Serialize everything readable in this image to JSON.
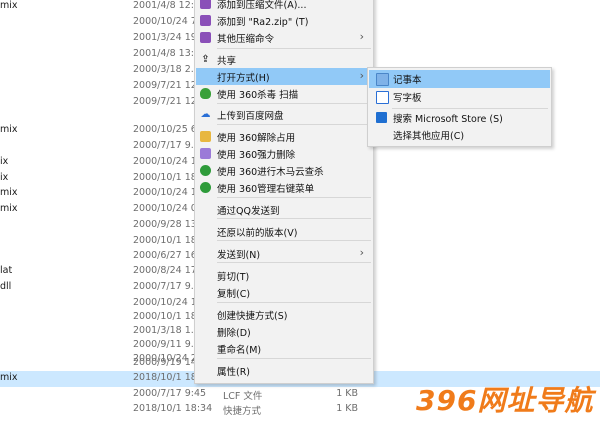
{
  "files": [
    {
      "name": "mix",
      "date": "2001/4/8 12:...",
      "type": "",
      "size": ""
    },
    {
      "name": "",
      "date": "2000/10/24 7...",
      "type": "",
      "size": ""
    },
    {
      "name": "",
      "date": "2001/3/24 19...",
      "type": "",
      "size": ""
    },
    {
      "name": "",
      "date": "2001/4/8 13:...",
      "type": "",
      "size": ""
    },
    {
      "name": "",
      "date": "2000/3/18 2...",
      "type": "",
      "size": ""
    },
    {
      "name": "",
      "date": "2009/7/21 12...",
      "type": "",
      "size": ""
    },
    {
      "name": "",
      "date": "2009/7/21 12...",
      "type": "",
      "size": ""
    },
    {
      "name": "mix",
      "date": "2000/10/25 6...",
      "type": "",
      "size": ""
    },
    {
      "name": "",
      "date": "2000/7/17 9...",
      "type": "",
      "size": ""
    },
    {
      "name": "ix",
      "date": "2000/10/24 1...",
      "type": "",
      "size": ""
    },
    {
      "name": "ix",
      "date": "2000/10/1 18...",
      "type": "",
      "size": ""
    },
    {
      "name": "mix",
      "date": "2000/10/24 1...",
      "type": "",
      "size": ""
    },
    {
      "name": "mix",
      "date": "2000/10/24 0...",
      "type": "",
      "size": ""
    },
    {
      "name": "",
      "date": "2000/9/28 13...",
      "type": "",
      "size": ""
    },
    {
      "name": "",
      "date": "2000/10/1 18...",
      "type": "",
      "size": ""
    },
    {
      "name": "",
      "date": "2000/6/27 16...",
      "type": "",
      "size": ""
    },
    {
      "name": "lat",
      "date": "2000/8/24 17...",
      "type": "",
      "size": ""
    },
    {
      "name": "dll",
      "date": "2000/7/17 9...",
      "type": "",
      "size": ""
    },
    {
      "name": "",
      "date": "2000/10/24 1...",
      "type": "",
      "size": ""
    },
    {
      "name": "",
      "date": "2000/10/1 18...",
      "type": "",
      "size": ""
    },
    {
      "name": "",
      "date": "2001/3/18 1...",
      "type": "",
      "size": ""
    },
    {
      "name": "",
      "date": "2000/9/11 9...",
      "type": "",
      "size": ""
    },
    {
      "name": "",
      "date": "2000/10/24 2...",
      "type": "",
      "size": ""
    },
    {
      "name": "",
      "date": "2000/9/19 14...",
      "type": "",
      "size": ""
    },
    {
      "name": "mix",
      "date": "2018/10/1 18...",
      "type": "",
      "size": ""
    },
    {
      "name": "",
      "date": "2000/7/17 9:45",
      "type": "LCF 文件",
      "size": "1 KB"
    },
    {
      "name": "",
      "date": "2018/10/1 18:34",
      "type": "快捷方式",
      "size": "1 KB"
    }
  ],
  "context_menu": {
    "items": [
      {
        "label": "添加到压缩文件(A)...",
        "icon": "archive-icon"
      },
      {
        "label": "添加到 \"Ra2.zip\" (T)",
        "icon": "archive-icon"
      },
      {
        "label": "其他压缩命令",
        "icon": "archive-icon"
      },
      {
        "label": "共享",
        "icon": "share-icon"
      },
      {
        "label": "打开方式(H)"
      },
      {
        "label": "使用 360杀毒 扫描",
        "icon": "360-shield-icon"
      },
      {
        "label": "上传到百度网盘",
        "icon": "baidu-cloud-icon"
      },
      {
        "label": "使用 360解除占用",
        "icon": "360-unlock-icon"
      },
      {
        "label": "使用 360强力删除",
        "icon": "360-delete-icon"
      },
      {
        "label": "使用 360进行木马云查杀",
        "icon": "360-trojan-icon"
      },
      {
        "label": "使用 360管理右键菜单",
        "icon": "360-menu-icon"
      },
      {
        "label": "通过QQ发送到"
      },
      {
        "label": "还原以前的版本(V)"
      },
      {
        "label": "发送到(N)"
      },
      {
        "label": "剪切(T)"
      },
      {
        "label": "复制(C)"
      },
      {
        "label": "创建快捷方式(S)"
      },
      {
        "label": "删除(D)"
      },
      {
        "label": "重命名(M)"
      },
      {
        "label": "属性(R)"
      }
    ]
  },
  "open_with_submenu": {
    "items": [
      {
        "label": "记事本",
        "icon": "notepad-icon"
      },
      {
        "label": "写字板",
        "icon": "wordpad-icon"
      },
      {
        "label": "搜索 Microsoft Store (S)",
        "icon": "store-icon"
      },
      {
        "label": "选择其他应用(C)"
      }
    ]
  },
  "watermark": "396网址导航",
  "colors": {
    "highlight": "#91c9f7",
    "selection": "#cce8ff",
    "watermark": "#f07b1a",
    "menu_bg": "#f2f2f2"
  }
}
